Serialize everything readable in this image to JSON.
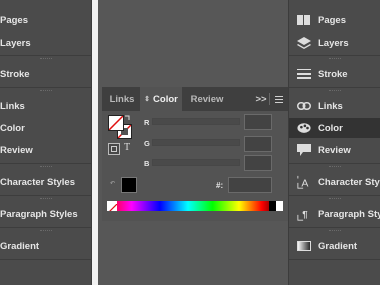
{
  "left_panel": {
    "items": [
      {
        "label": "Pages"
      },
      {
        "label": "Layers"
      },
      {
        "label": "Stroke"
      },
      {
        "label": "Links"
      },
      {
        "label": "Color"
      },
      {
        "label": "Review"
      },
      {
        "label": "Character Styles"
      },
      {
        "label": "Paragraph Styles"
      },
      {
        "label": "Gradient"
      }
    ]
  },
  "right_panel": {
    "items": [
      {
        "label": "Pages",
        "icon": "pages-icon"
      },
      {
        "label": "Layers",
        "icon": "layers-icon"
      },
      {
        "label": "Stroke",
        "icon": "stroke-icon"
      },
      {
        "label": "Links",
        "icon": "links-icon"
      },
      {
        "label": "Color",
        "icon": "color-icon"
      },
      {
        "label": "Review",
        "icon": "review-icon"
      },
      {
        "label": "Character Styles",
        "icon": "character-styles-icon"
      },
      {
        "label": "Paragraph Styles",
        "icon": "paragraph-styles-icon"
      },
      {
        "label": "Gradient",
        "icon": "gradient-icon"
      }
    ]
  },
  "color_panel": {
    "tabs": [
      {
        "label": "Links"
      },
      {
        "label": "Color",
        "active": true
      },
      {
        "label": "Review"
      }
    ],
    "overflow_label": ">>",
    "sliders": [
      {
        "label": "R",
        "value": ""
      },
      {
        "label": "G",
        "value": ""
      },
      {
        "label": "B",
        "value": ""
      }
    ],
    "format_text_label": "T",
    "hex_label": "#:",
    "hex_value": "",
    "swatch_color": "#000000"
  }
}
